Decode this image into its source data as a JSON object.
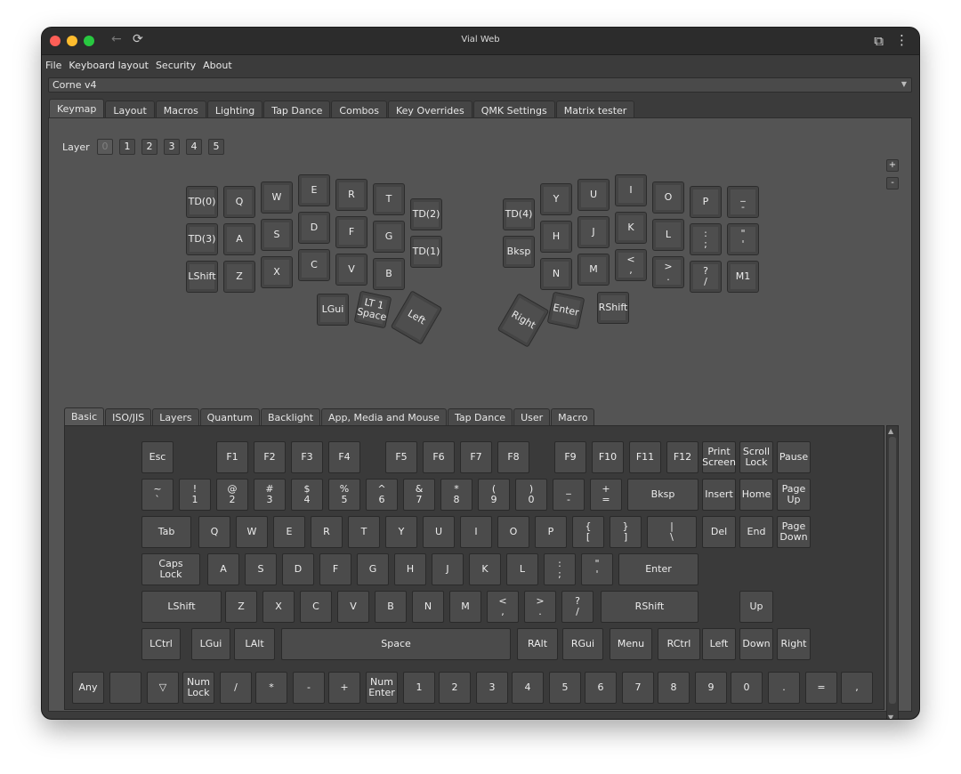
{
  "window": {
    "title": "Vial Web",
    "back_glyph": "←",
    "reload_glyph": "⟳",
    "extension_glyph": "⧉",
    "kebab_glyph": "⋮"
  },
  "menu": [
    "File",
    "Keyboard layout",
    "Security",
    "About"
  ],
  "device": {
    "selected": "Corne v4",
    "arrow": "▼"
  },
  "tabs": [
    {
      "label": "Keymap",
      "active": true
    },
    {
      "label": "Layout"
    },
    {
      "label": "Macros"
    },
    {
      "label": "Lighting"
    },
    {
      "label": "Tap Dance"
    },
    {
      "label": "Combos"
    },
    {
      "label": "Key Overrides"
    },
    {
      "label": "QMK Settings"
    },
    {
      "label": "Matrix tester"
    }
  ],
  "layers": {
    "label": "Layer",
    "items": [
      "0",
      "1",
      "2",
      "3",
      "4",
      "5"
    ],
    "active": 0
  },
  "zoom": {
    "plus": "+",
    "minus": "-"
  },
  "keymap": {
    "left": [
      "TD(0)",
      "Q",
      "W",
      "E",
      "R",
      "T",
      "TD(2)",
      "TD(3)",
      "A",
      "S",
      "D",
      "F",
      "G",
      "TD(1)",
      "LShift",
      "Z",
      "X",
      "C",
      "V",
      "B"
    ],
    "right": [
      "TD(4)",
      "Y",
      "U",
      "I",
      "O",
      "P",
      "_\n-",
      "Bksp",
      "H",
      "J",
      "K",
      "L",
      ":\n;",
      "\"\n'",
      "N",
      "M",
      "<\n,",
      ">\n.",
      "?\n/",
      "M1"
    ],
    "thumbs": [
      "LGui",
      "LT 1\nSpace",
      "Left",
      "Right",
      "Enter",
      "RShift"
    ]
  },
  "subtabs": [
    {
      "label": "Basic",
      "active": true
    },
    {
      "label": "ISO/JIS"
    },
    {
      "label": "Layers"
    },
    {
      "label": "Quantum"
    },
    {
      "label": "Backlight"
    },
    {
      "label": "App, Media and Mouse"
    },
    {
      "label": "Tap Dance"
    },
    {
      "label": "User"
    },
    {
      "label": "Macro"
    }
  ],
  "palette": {
    "row0": [
      "Esc",
      "F1",
      "F2",
      "F3",
      "F4",
      "F5",
      "F6",
      "F7",
      "F8",
      "F9",
      "F10",
      "F11",
      "F12",
      "Print\nScreen",
      "Scroll\nLock",
      "Pause"
    ],
    "row1": [
      "~\n`",
      "!\n1",
      "@\n2",
      "#\n3",
      "$\n4",
      "%\n5",
      "^\n6",
      "&\n7",
      "*\n8",
      "(\n9",
      ")\n0",
      "_\n-",
      "+\n=",
      "Bksp",
      "Insert",
      "Home",
      "Page\nUp"
    ],
    "row2": [
      "Tab",
      "Q",
      "W",
      "E",
      "R",
      "T",
      "Y",
      "U",
      "I",
      "O",
      "P",
      "{\n[",
      "}\n]",
      "|\n\\",
      "Del",
      "End",
      "Page\nDown"
    ],
    "row3": [
      "Caps\nLock",
      "A",
      "S",
      "D",
      "F",
      "G",
      "H",
      "J",
      "K",
      "L",
      ":\n;",
      "\"\n'",
      "Enter"
    ],
    "row4": [
      "LShift",
      "Z",
      "X",
      "C",
      "V",
      "B",
      "N",
      "M",
      "<\n,",
      ">\n.",
      "?\n/",
      "RShift",
      "Up"
    ],
    "row5": [
      "LCtrl",
      "LGui",
      "LAlt",
      "Space",
      "RAlt",
      "RGui",
      "Menu",
      "RCtrl",
      "Left",
      "Down",
      "Right"
    ],
    "row6": [
      "Any",
      "",
      "▽",
      "Num\nLock",
      "/",
      "*",
      "-",
      "+",
      "Num\nEnter",
      "1",
      "2",
      "3",
      "4",
      "5",
      "6",
      "7",
      "8",
      "9",
      "0",
      ".",
      "=",
      ","
    ],
    "row7": [
      "",
      "!",
      "@",
      "#",
      "$",
      "%",
      "^",
      "&",
      "*",
      "(",
      ")",
      "_",
      "+",
      "{",
      "}",
      "<",
      ">",
      ":",
      "|",
      "?",
      "\""
    ]
  },
  "scroll": {
    "up": "▲",
    "down": "▼"
  }
}
